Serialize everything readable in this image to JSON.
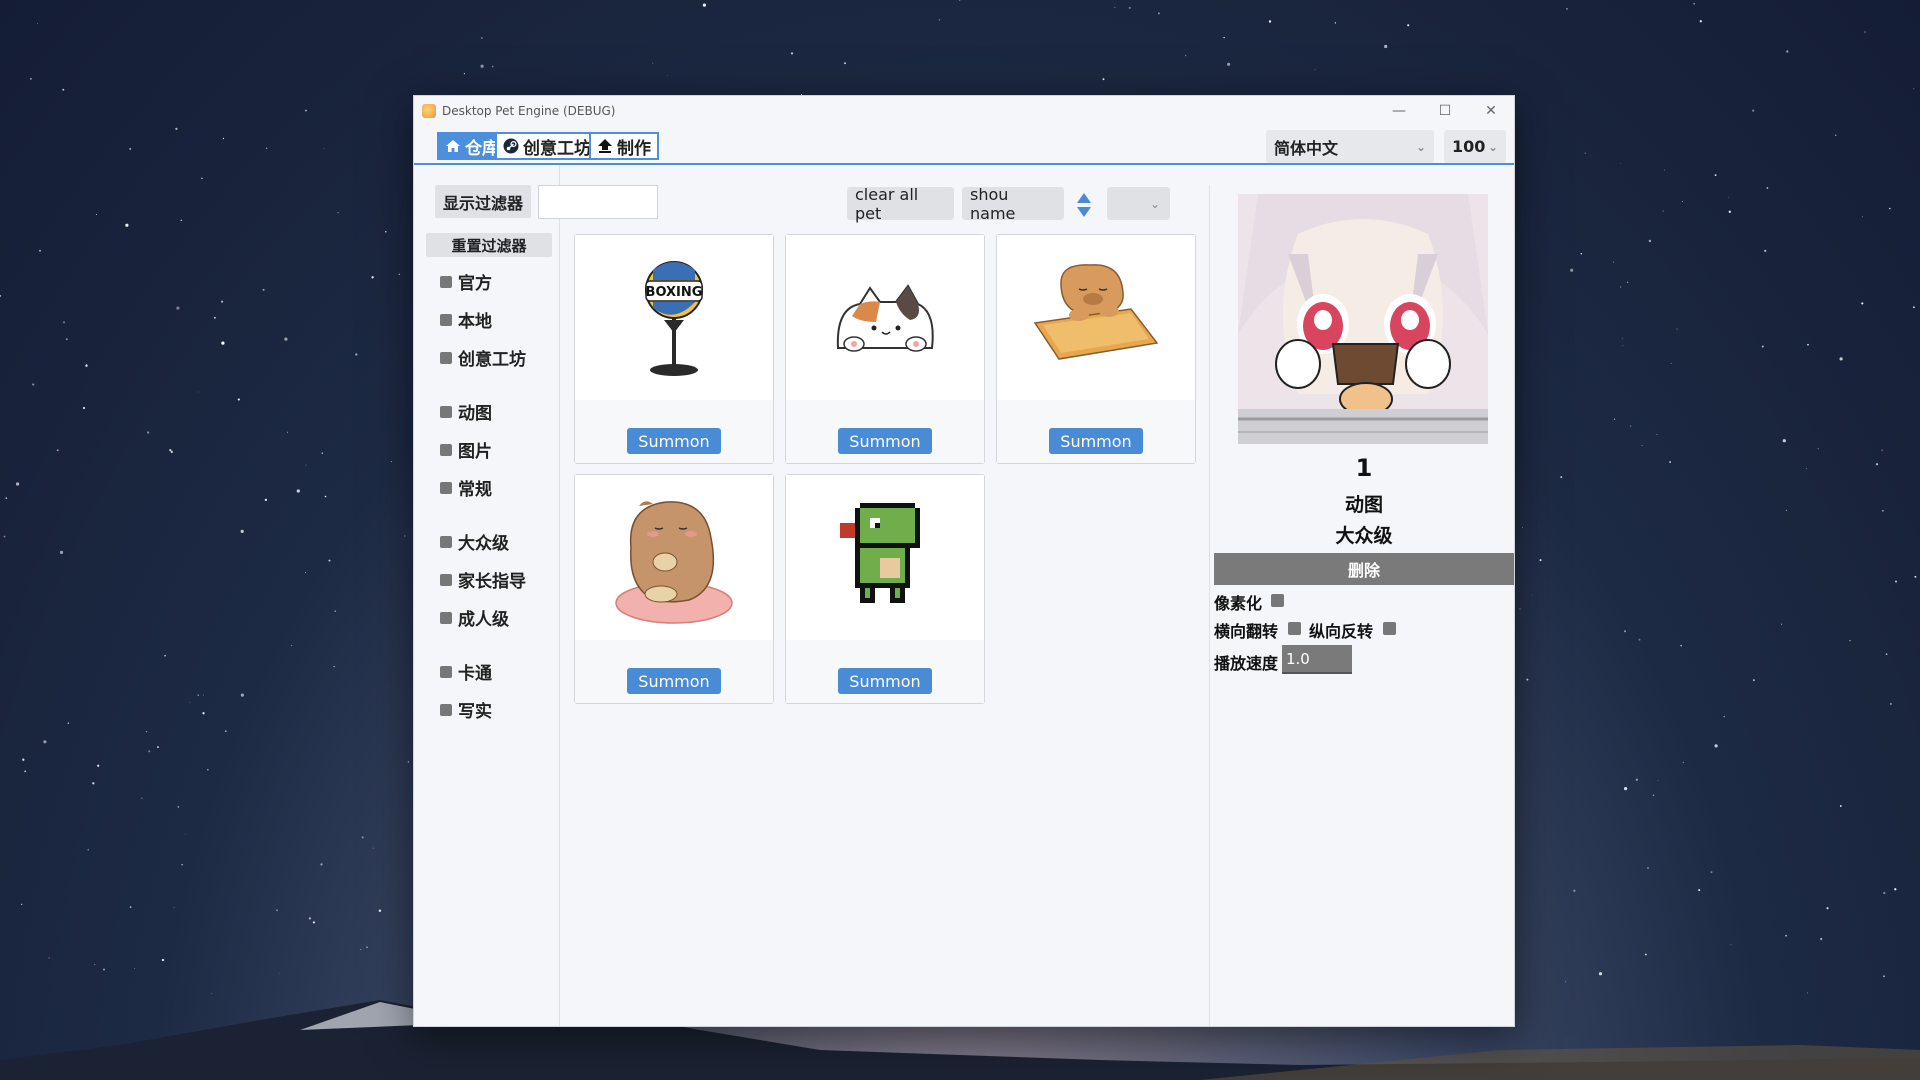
{
  "window": {
    "title": "Desktop Pet Engine (DEBUG)",
    "minimize": "—",
    "maximize": "☐",
    "close": "✕"
  },
  "tabs": [
    {
      "label": "仓库",
      "icon": "home-icon",
      "active": true
    },
    {
      "label": "创意工坊",
      "icon": "steam-icon",
      "active": false
    },
    {
      "label": "制作",
      "icon": "upload-icon",
      "active": false
    }
  ],
  "language": {
    "selected": "简体中文"
  },
  "zoom": {
    "selected": "100"
  },
  "filter": {
    "show_label": "显示过滤器",
    "reset_label": "重置过滤器",
    "input_value": "",
    "groups": [
      [
        "官方",
        "本地",
        "创意工坊"
      ],
      [
        "动图",
        "图片",
        "常规"
      ],
      [
        "大众级",
        "家长指导",
        "成人级"
      ],
      [
        "卡通",
        "写实"
      ]
    ]
  },
  "toolbar": {
    "clear_all_label": "clear all pet",
    "show_name_label": "shou name",
    "sort_value": ""
  },
  "pets": [
    {
      "art": "boxing-bag",
      "summon_label": "Summon",
      "text": "BOXING"
    },
    {
      "art": "cat",
      "summon_label": "Summon"
    },
    {
      "art": "capybara-keyboard",
      "summon_label": "Summon"
    },
    {
      "art": "capybara-sitting",
      "summon_label": "Summon"
    },
    {
      "art": "pixel-dino",
      "summon_label": "Summon"
    }
  ],
  "selected_pet": {
    "id": "1",
    "type": "动图",
    "rating": "大众级",
    "delete_label": "删除",
    "pixelate_label": "像素化",
    "flip_h_label": "横向翻转",
    "flip_v_label": "纵向反转",
    "speed_label": "播放速度",
    "speed_value": "1.0"
  },
  "colors": {
    "accent": "#4c8fdc",
    "summon": "#4a8bd6",
    "delete": "#7a7a7a"
  }
}
